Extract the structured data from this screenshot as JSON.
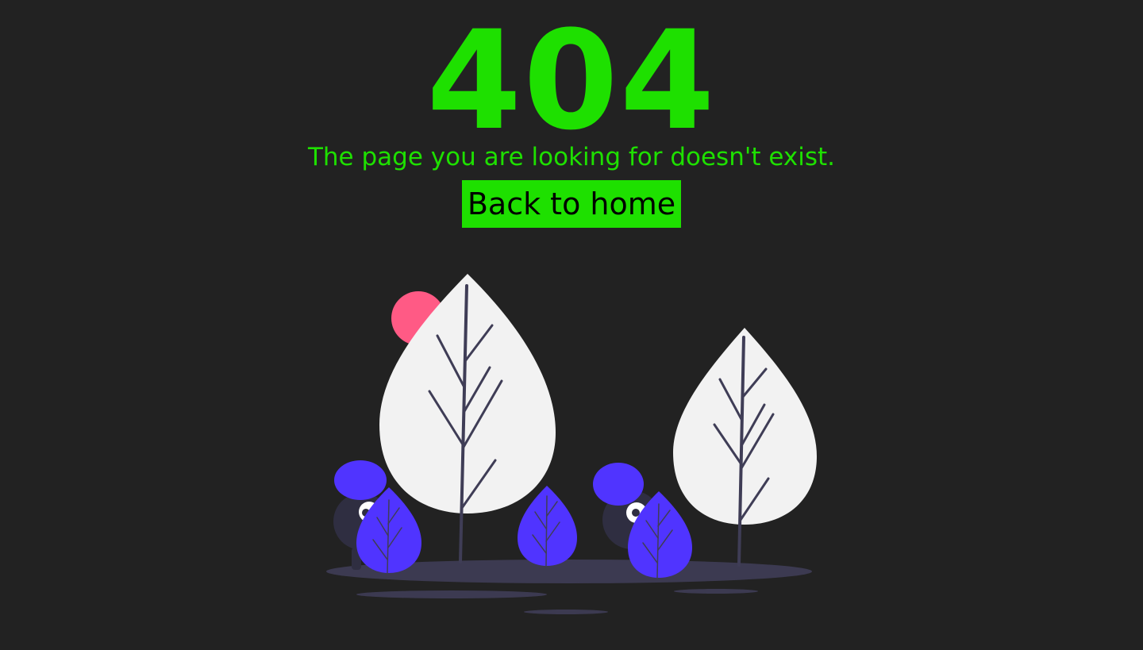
{
  "error": {
    "code": "404",
    "message": "The page you are looking for doesn't exist.",
    "home_button_label": "Back to home"
  },
  "colors": {
    "background": "#222222",
    "accent": "#1ee000",
    "button_text": "#000000",
    "tree_leaf": "#f2f2f2",
    "branch": "#3f3d56",
    "bush": "#5034ff",
    "sun": "#ff5a85",
    "ground": "#3f3d56"
  },
  "illustration": {
    "icon": "trees-with-hiding-creatures-illustration"
  }
}
